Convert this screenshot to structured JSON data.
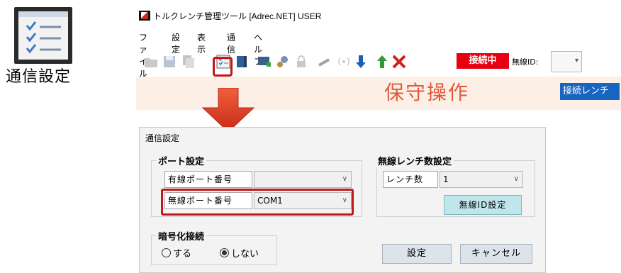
{
  "left_panel": {
    "icon_name": "settings-list-icon",
    "label": "通信設定"
  },
  "window": {
    "title": "トルクレンチ管理ツール [Adrec.NET] USER",
    "menu": [
      "ファイル",
      "設定",
      "表示",
      "通信",
      "ヘルプ"
    ],
    "status_label": "接続中",
    "wireless_id_label": "無線ID:",
    "wireless_id_value": "",
    "mode_text": "保守操作",
    "connect_button": "接続レンチ",
    "colors": {
      "status": "#e60012",
      "mode_text": "#e05a3c",
      "connect_button": "#1765c0",
      "highlight": "#c0181b"
    }
  },
  "dialog": {
    "title": "通信設定",
    "port_group": {
      "title": "ポート設定",
      "wired_label": "有線ポート番号",
      "wired_value": "",
      "wireless_label": "無線ポート番号",
      "wireless_value": "COM1"
    },
    "wrench_group": {
      "title": "無線レンチ数設定",
      "count_label": "レンチ数",
      "count_value": "1",
      "wireless_id_button": "無線ID設定"
    },
    "encrypt_group": {
      "title": "暗号化接続",
      "options": [
        "する",
        "しない"
      ],
      "selected": "しない"
    },
    "ok_button": "設定",
    "cancel_button": "キャンセル"
  }
}
